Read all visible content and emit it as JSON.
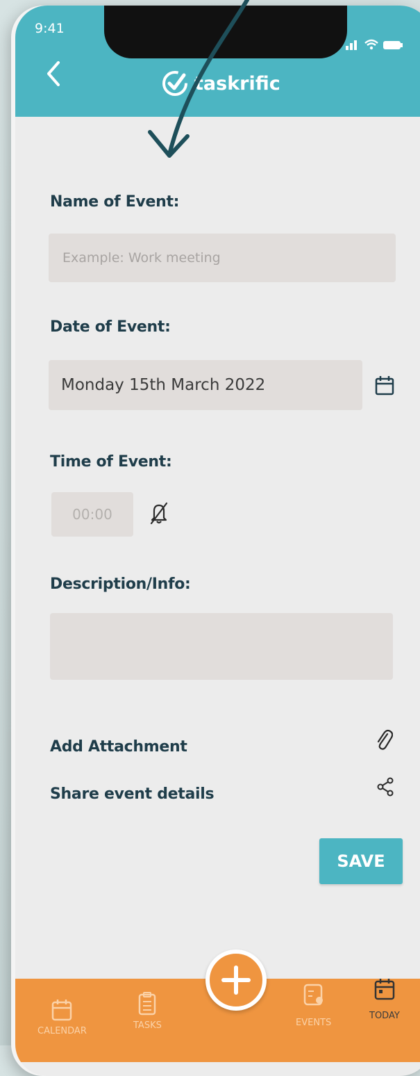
{
  "status_bar": {
    "time": "9:41"
  },
  "header": {
    "app_name": "taskrific"
  },
  "form": {
    "name_label": "Name of Event:",
    "name_placeholder": "Example: Work meeting",
    "date_label": "Date of Event:",
    "date_value": "Monday 15th March 2022",
    "time_label": "Time of Event:",
    "time_value": "00:00",
    "description_label": "Description/Info:",
    "attachment_label": "Add Attachment",
    "share_label": "Share event details",
    "save_label": "SAVE"
  },
  "bottom_nav": {
    "items": [
      {
        "label": "CALENDAR",
        "icon": "calendar-icon"
      },
      {
        "label": "TASKS",
        "icon": "clipboard-icon"
      },
      {
        "label": "EVENTS",
        "icon": "events-icon"
      },
      {
        "label": "TODAY",
        "icon": "today-icon"
      }
    ]
  },
  "colors": {
    "header": "#4cb5c2",
    "nav": "#ef9540",
    "label": "#1f3d4a",
    "arrow": "#1e4f5a"
  }
}
